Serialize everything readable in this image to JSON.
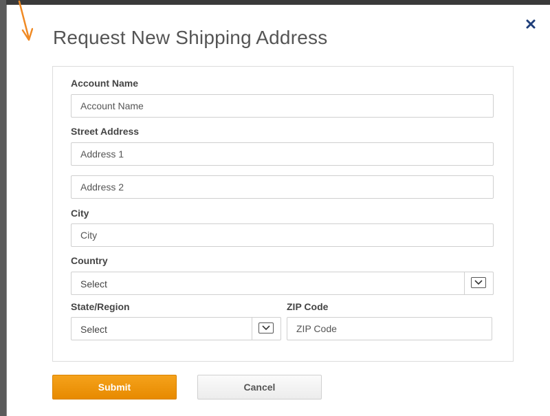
{
  "dialog": {
    "title": "Request New Shipping Address"
  },
  "form": {
    "account_name": {
      "label": "Account Name",
      "placeholder": "Account Name",
      "value": ""
    },
    "street_address": {
      "label": "Street Address",
      "address1_placeholder": "Address 1",
      "address2_placeholder": "Address 2"
    },
    "city": {
      "label": "City",
      "placeholder": "City"
    },
    "country": {
      "label": "Country",
      "selected": "Select"
    },
    "state_region": {
      "label": "State/Region",
      "selected": "Select"
    },
    "zip": {
      "label": "ZIP Code",
      "placeholder": "ZIP Code"
    }
  },
  "actions": {
    "submit_label": "Submit",
    "cancel_label": "Cancel"
  },
  "icons": {
    "close": "close-icon",
    "annotation": "arrow-icon",
    "dropdown": "chevron-down-icon"
  },
  "colors": {
    "accent": "#f39c12",
    "annotation_arrow": "#f08a24",
    "close_icon": "#1f3f7a",
    "title_text": "#555555"
  }
}
